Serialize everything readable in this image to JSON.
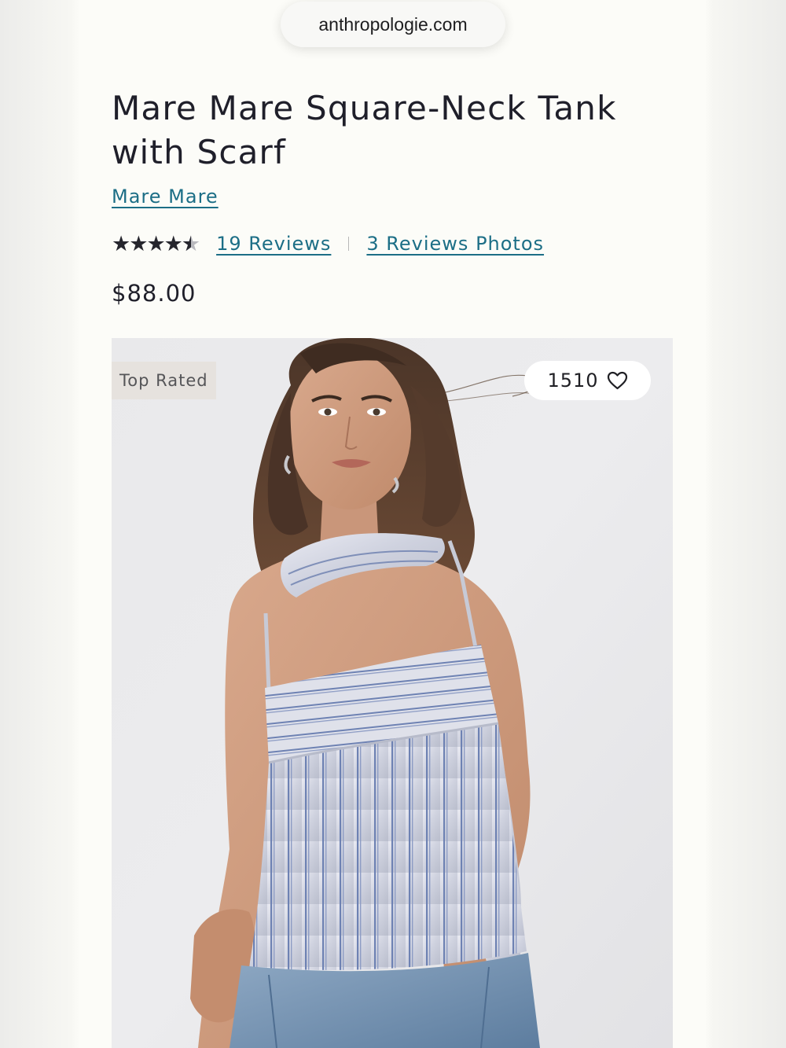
{
  "browser": {
    "url": "anthropologie.com"
  },
  "product": {
    "title": "Mare Mare Square-Neck Tank with Scarf",
    "brand": "Mare Mare",
    "rating": 4.5,
    "max_rating": 5,
    "reviews_link": "19 Reviews",
    "photos_link": "3 Reviews Photos",
    "price": "$88.00"
  },
  "image": {
    "badge": "Top Rated",
    "like_count": "1510",
    "like_icon": "heart-outline-icon",
    "description_alt": "Model wearing a striped satin square-neck tank with scarf and blue jeans"
  },
  "colors": {
    "link": "#1c6e86",
    "text": "#1f1f2a",
    "badge_bg": "#e6e2de",
    "page_bg": "#fcfcf8"
  }
}
